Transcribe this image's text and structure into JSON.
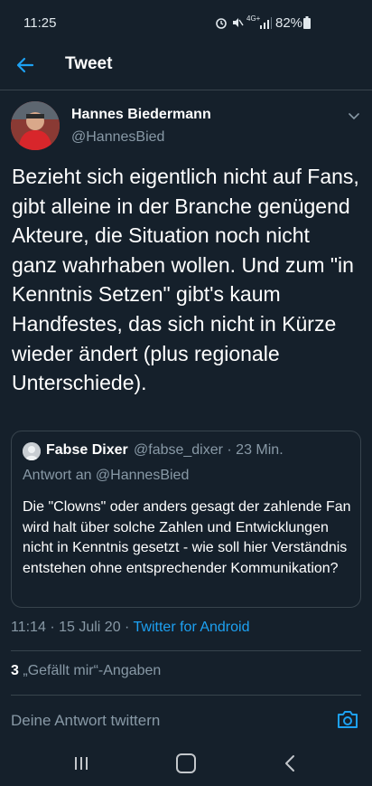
{
  "status": {
    "time": "11:25",
    "battery": "82%",
    "network": "4G+"
  },
  "header": {
    "title": "Tweet"
  },
  "tweet": {
    "author_name": "Hannes Biedermann",
    "author_handle": "@HannesBied",
    "text": "Bezieht sich eigentlich nicht auf Fans, gibt alleine in der Branche genügend Akteure, die Situation noch nicht ganz wahrhaben wollen. Und zum \"in Kenntnis Setzen\" gibt's kaum Handfestes, das sich nicht in Kürze\nwieder ändert (plus regionale Unterschiede).",
    "time": "11:14",
    "date": "15 Juli 20",
    "source": "Twitter for Android",
    "like_count": "3",
    "like_label": "„Gefällt mir“-Angaben"
  },
  "quote": {
    "name": "Fabse Dixer",
    "handle": "@fabse_dixer · 23 Min.",
    "reply_to": "Antwort an @HannesBied",
    "text": "Die \"Clowns\" oder anders gesagt der zahlende Fan wird halt über solche Zahlen und Entwicklungen nicht in Kenntnis gesetzt - wie soll hier Verständnis entstehen ohne entsprechender Kommunikation?"
  },
  "reply": {
    "placeholder": "Deine Antwort twittern"
  },
  "colors": {
    "background": "#15202b",
    "accent": "#1da1f2",
    "secondary_text": "#8899a6",
    "border": "#38444d"
  }
}
